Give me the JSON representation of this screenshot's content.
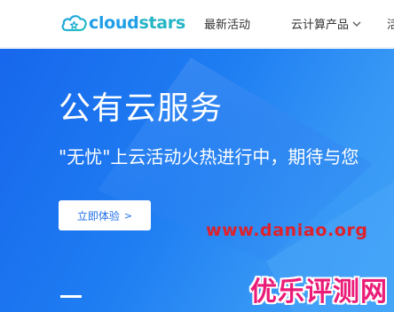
{
  "brand": {
    "logo_part1": "cloud",
    "logo_part2": "stars",
    "colors": {
      "primary": "#1f9fe6",
      "secondary": "#26b5c6"
    }
  },
  "nav": {
    "items": [
      {
        "label": "最新活动"
      },
      {
        "label": "云计算产品",
        "icon": "chevron-down-icon"
      },
      {
        "label": "活动"
      }
    ]
  },
  "hero": {
    "title": "公有云服务",
    "subtitle": "\"无忧\"上云活动火热进行中，期待与您",
    "cta_label": "立即体验",
    "cta_icon": ">",
    "background": "#1f7ef2"
  },
  "watermarks": {
    "url": "www.daniao.org",
    "site": "优乐评测网",
    "colors": {
      "url": "#e0202a",
      "site": "#ea1c78"
    }
  }
}
